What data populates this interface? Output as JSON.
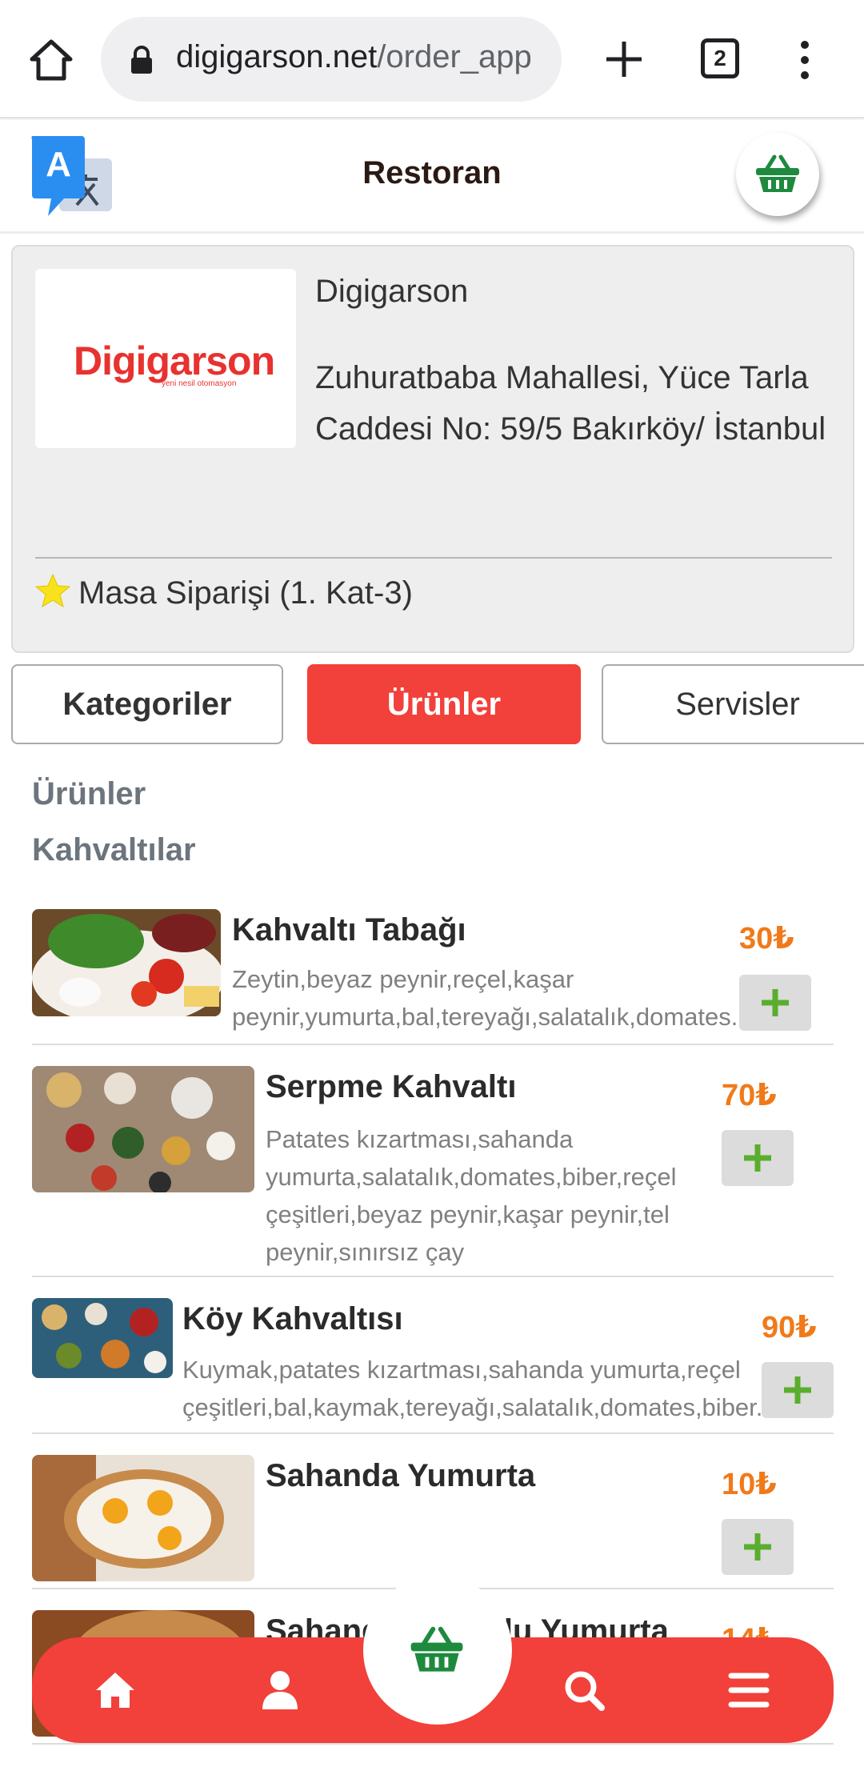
{
  "browser": {
    "url_host": "digigarson.net",
    "url_path": "/order_app",
    "tab_count": "2"
  },
  "header": {
    "title": "Restoran"
  },
  "restaurant": {
    "logo_text": "Digigarson",
    "logo_tagline": "yeni nesil otomasyon",
    "name": "Digigarson",
    "address": "Zuhuratbaba Mahallesi, Yüce Tarla Caddesi No: 59/5 Bakırköy/ İstanbul",
    "table": "Masa Siparişi (1. Kat-3)"
  },
  "tabs": {
    "categories": "Kategoriler",
    "products": "Ürünler",
    "services": "Servisler"
  },
  "breadcrumb": {
    "section": "Ürünler",
    "category": "Kahvaltılar"
  },
  "products": [
    {
      "name": "Kahvaltı Tabağı",
      "description": "Zeytin,beyaz peynir,reçel,kaşar peynir,yumurta,bal,tereyağı,salatalık,domates.",
      "price": "30₺"
    },
    {
      "name": "Serpme Kahvaltı",
      "description": "Patates kızartması,sahanda yumurta,salatalık,domates,biber,reçel çeşitleri,beyaz peynir,kaşar peynir,tel peynir,sınırsız çay",
      "price": "70₺"
    },
    {
      "name": "Köy Kahvaltısı",
      "description": "Kuymak,patates kızartması,sahanda yumurta,reçel çeşitleri,bal,kaymak,tereyağı,salatalık,domates,biber.",
      "price": "90₺"
    },
    {
      "name": "Sahanda Yumurta",
      "description": "",
      "price": "10₺"
    },
    {
      "name": "Sahanda Sucuklu Yumurta",
      "description": "",
      "price": "14₺"
    }
  ],
  "colors": {
    "accent": "#f2403a",
    "price": "#f07a1a",
    "add": "#5aae2e",
    "cart": "#1e8a3e"
  }
}
